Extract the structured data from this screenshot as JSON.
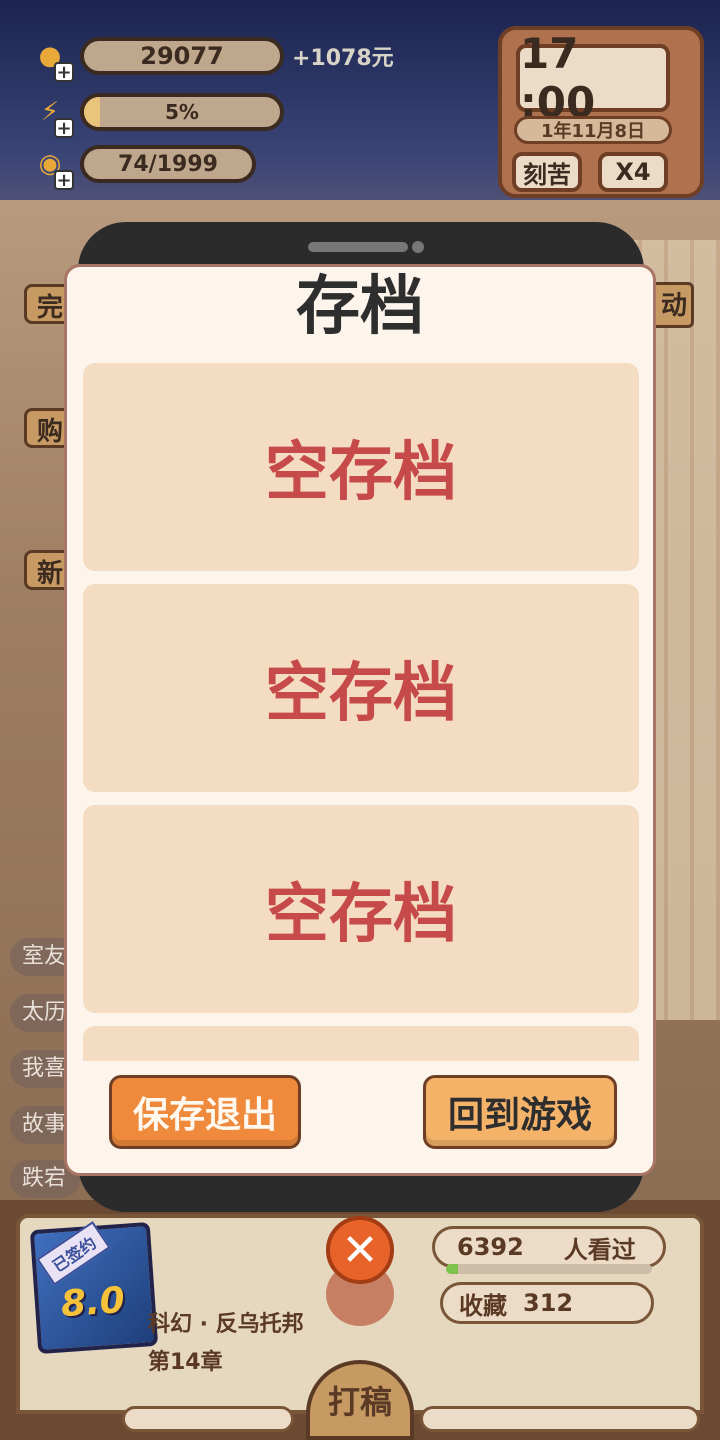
{
  "stats": {
    "coins": "29077",
    "coins_extra": "+1078元",
    "energy": "5%",
    "energy_fraction": 0.05,
    "inspiration": "74/1999",
    "inspiration_fraction": 0.037
  },
  "clock": {
    "time": "17 :00",
    "date": "1年11月8日",
    "mode_label": "刻苦",
    "speed_label": "X4"
  },
  "background": {
    "side_buttons": [
      "完",
      "购",
      "新"
    ],
    "side_tags": [
      "室友",
      "太历",
      "我喜",
      "故事",
      "跌宕"
    ],
    "right_label": "动"
  },
  "dialog": {
    "title": "存档",
    "slots": [
      "空存档",
      "空存档",
      "空存档",
      ""
    ],
    "save_exit_label": "保存退出",
    "return_label": "回到游戏"
  },
  "book": {
    "badge": "已签约",
    "score": "8.0",
    "genre_title": "科幻 · 反乌托邦",
    "chapter": "第14章"
  },
  "audience": {
    "viewers_count": "6392",
    "viewers_label": "人看过",
    "viewers_fraction": 0.06,
    "collect_label": "收藏",
    "collect_count": "312"
  },
  "actions": {
    "close_icon": "close-icon",
    "write_label": "打稿"
  },
  "colors": {
    "dialog_bg": "#fdf5ec",
    "slot_bg": "#f4dcc2",
    "slot_text": "#c64a4a",
    "save_button": "#ef8a3c",
    "return_button": "#f5b36a"
  }
}
